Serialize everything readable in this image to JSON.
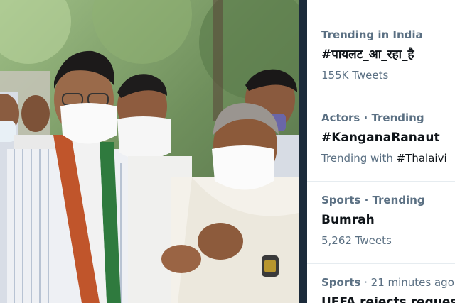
{
  "trends": [
    {
      "context": "Trending in India",
      "context_suffix": "",
      "name": "#पायलट_आ_रहा_है",
      "meta_prefix": "155K Tweets",
      "meta_highlight": ""
    },
    {
      "context": "Actors · Trending",
      "context_suffix": "",
      "name": "#KanganaRanaut",
      "meta_prefix": "Trending with ",
      "meta_highlight": "#Thalaivi"
    },
    {
      "context": "Sports · Trending",
      "context_suffix": "",
      "name": "Bumrah",
      "meta_prefix": "5,262 Tweets",
      "meta_highlight": ""
    },
    {
      "context": "Sports",
      "context_suffix": " · 21 minutes ago",
      "name": "UEFA rejects request t",
      "meta_prefix": "",
      "meta_highlight": ""
    }
  ],
  "colors": {
    "divider": "#1b2a3a",
    "secondary_text": "#5b7083",
    "primary_text": "#0f1419"
  }
}
